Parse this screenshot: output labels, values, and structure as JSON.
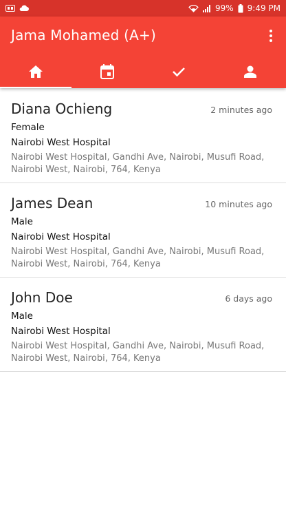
{
  "status_bar": {
    "battery": "99%",
    "time": "9:49 PM"
  },
  "app_bar": {
    "title": "Jama Mohamed (A+)"
  },
  "tabs": [
    {
      "icon": "home-icon",
      "active": true
    },
    {
      "icon": "calendar-icon",
      "active": false
    },
    {
      "icon": "check-icon",
      "active": false
    },
    {
      "icon": "person-icon",
      "active": false
    }
  ],
  "entries": [
    {
      "name": "Diana Ochieng",
      "time": "2 minutes ago",
      "gender": "Female",
      "hospital": "Nairobi West Hospital",
      "address": "Nairobi West Hospital, Gandhi Ave, Nairobi, Musufi Road, Nairobi West, Nairobi, 764, Kenya"
    },
    {
      "name": "James Dean",
      "time": "10 minutes ago",
      "gender": "Male",
      "hospital": "Nairobi West Hospital",
      "address": "Nairobi West Hospital, Gandhi Ave, Nairobi, Musufi Road, Nairobi West, Nairobi, 764, Kenya"
    },
    {
      "name": "John Doe",
      "time": "6 days ago",
      "gender": "Male",
      "hospital": "Nairobi West Hospital",
      "address": "Nairobi West Hospital, Gandhi Ave, Nairobi, Musufi Road, Nairobi West, Nairobi, 764, Kenya"
    }
  ],
  "colors": {
    "primary": "#f44336",
    "status_bar": "#d7332a"
  }
}
